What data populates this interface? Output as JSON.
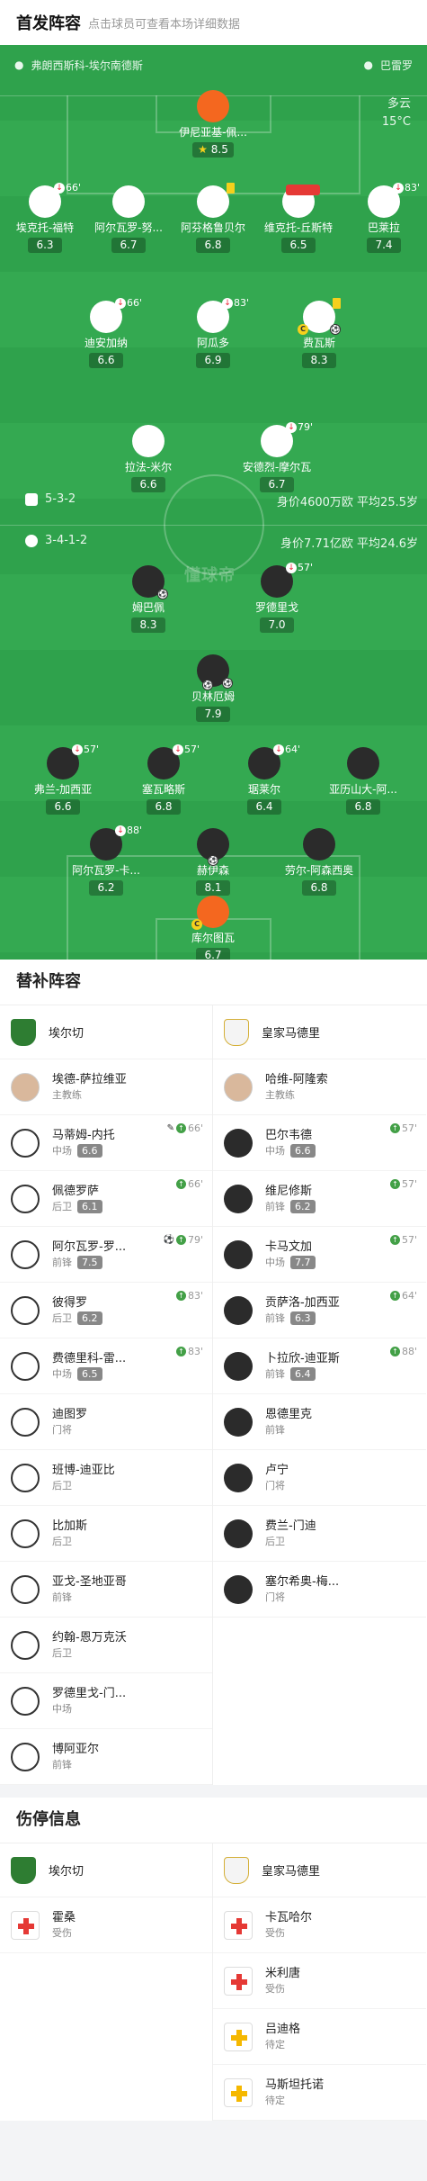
{
  "header": {
    "title": "首发阵容",
    "subtitle": "点击球员可查看本场详细数据"
  },
  "pitch": {
    "home_coach": "弗朗西斯科-埃尔南德斯",
    "away_coach": "巴雷罗",
    "weather": "多云",
    "temp": "15°C",
    "watermark": "懂球帝",
    "home_formation": "5-3-2",
    "home_value": "身价4600万欧 平均25.5岁",
    "away_formation": "3-4-1-2",
    "away_value": "身价7.71亿欧 平均24.6岁"
  },
  "home_players": [
    {
      "name": "伊尼亚基-佩...",
      "rating": "8.5",
      "star": true
    },
    {
      "name": "埃克托-福特",
      "rating": "6.3",
      "sub": "66'"
    },
    {
      "name": "阿尔瓦罗-努...",
      "rating": "6.7"
    },
    {
      "name": "阿芬格鲁贝尔",
      "rating": "6.8",
      "card": "yellow"
    },
    {
      "name": "维克托-丘斯特",
      "rating": "6.5",
      "card": "red"
    },
    {
      "name": "巴莱拉",
      "rating": "7.4",
      "sub": "83'"
    },
    {
      "name": "迪安加纳",
      "rating": "6.6",
      "sub": "66'"
    },
    {
      "name": "阿瓜多",
      "rating": "6.9",
      "sub": "83'"
    },
    {
      "name": "费瓦斯",
      "rating": "8.3",
      "card": "yellow"
    },
    {
      "name": "拉法-米尔",
      "rating": "6.6"
    },
    {
      "name": "安德烈-摩尔瓦",
      "rating": "6.7",
      "sub": "79'"
    }
  ],
  "away_players": [
    {
      "name": "姆巴佩",
      "rating": "8.3"
    },
    {
      "name": "罗德里戈",
      "rating": "7.0",
      "sub": "57'"
    },
    {
      "name": "贝林厄姆",
      "rating": "7.9"
    },
    {
      "name": "弗兰-加西亚",
      "rating": "6.6",
      "sub": "57'"
    },
    {
      "name": "塞瓦略斯",
      "rating": "6.8",
      "sub": "57'"
    },
    {
      "name": "琚莱尔",
      "rating": "6.4",
      "sub": "64'"
    },
    {
      "name": "亚历山大-阿...",
      "rating": "6.8"
    },
    {
      "name": "阿尔瓦罗-卡...",
      "rating": "6.2",
      "sub": "88'"
    },
    {
      "name": "赫伊森",
      "rating": "8.1"
    },
    {
      "name": "劳尔-阿森西奥",
      "rating": "6.8"
    },
    {
      "name": "库尔图瓦",
      "rating": "6.7"
    }
  ],
  "subs": {
    "title": "替补阵容",
    "home": {
      "team": "埃尔切",
      "coach": "埃德-萨拉维亚",
      "coach_role": "主教练",
      "players": [
        {
          "name": "马蒂姆-内托",
          "pos": "中场",
          "rating": "6.6",
          "ev": "66'"
        },
        {
          "name": "佩德罗萨",
          "pos": "后卫",
          "rating": "6.1",
          "ev": "66'"
        },
        {
          "name": "阿尔瓦罗-罗...",
          "pos": "前锋",
          "rating": "7.5",
          "ev": "79'"
        },
        {
          "name": "彼得罗",
          "pos": "后卫",
          "rating": "6.2",
          "ev": "83'"
        },
        {
          "name": "费德里科-雷...",
          "pos": "中场",
          "rating": "6.5",
          "ev": "83'"
        },
        {
          "name": "迪图罗",
          "pos": "门将"
        },
        {
          "name": "班博-迪亚比",
          "pos": "后卫"
        },
        {
          "name": "比加斯",
          "pos": "后卫"
        },
        {
          "name": "亚戈-圣地亚哥",
          "pos": "前锋"
        },
        {
          "name": "约翰-恩万克沃",
          "pos": "后卫"
        },
        {
          "name": "罗德里戈-门...",
          "pos": "中场"
        },
        {
          "name": "博阿亚尔",
          "pos": "前锋"
        }
      ]
    },
    "away": {
      "team": "皇家马德里",
      "coach": "哈维-阿隆索",
      "coach_role": "主教练",
      "players": [
        {
          "name": "巴尔韦德",
          "pos": "中场",
          "rating": "6.6",
          "ev": "57'"
        },
        {
          "name": "维尼修斯",
          "pos": "前锋",
          "rating": "6.2",
          "ev": "57'"
        },
        {
          "name": "卡马文加",
          "pos": "中场",
          "rating": "7.7",
          "ev": "57'"
        },
        {
          "name": "贡萨洛-加西亚",
          "pos": "前锋",
          "rating": "6.3",
          "ev": "64'"
        },
        {
          "name": "卜拉欣-迪亚斯",
          "pos": "前锋",
          "rating": "6.4",
          "ev": "88'"
        },
        {
          "name": "恩德里克",
          "pos": "前锋"
        },
        {
          "name": "卢宁",
          "pos": "门将"
        },
        {
          "name": "费兰-门迪",
          "pos": "后卫"
        },
        {
          "name": "塞尔希奥-梅...",
          "pos": "门将"
        }
      ]
    }
  },
  "injuries": {
    "title": "伤停信息",
    "home": {
      "team": "埃尔切",
      "players": [
        {
          "name": "霍桑",
          "status": "受伤"
        }
      ]
    },
    "away": {
      "team": "皇家马德里",
      "players": [
        {
          "name": "卡瓦哈尔",
          "status": "受伤"
        },
        {
          "name": "米利唐",
          "status": "受伤"
        },
        {
          "name": "吕迪格",
          "status": "待定"
        },
        {
          "name": "马斯坦托诺",
          "status": "待定"
        }
      ]
    }
  },
  "colors": {
    "pitch": "#2fa24c",
    "home_kit": "#ffffff",
    "away_kit": "#2b2b2b",
    "goalkeeper": "#f4671f"
  }
}
